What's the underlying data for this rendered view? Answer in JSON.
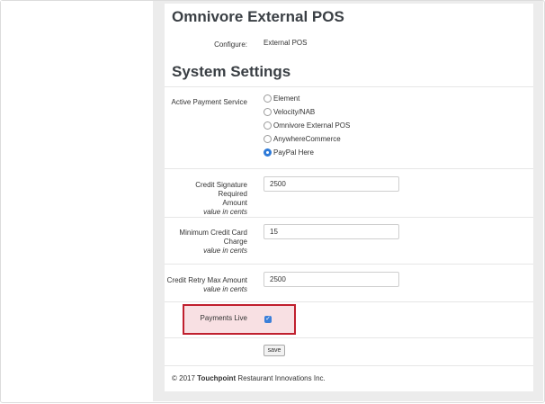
{
  "header": {
    "title": "Omnivore External POS"
  },
  "configure": {
    "label": "Configure:",
    "value": "External POS"
  },
  "system_settings": {
    "title": "System Settings"
  },
  "payment_service": {
    "label": "Active Payment Service",
    "options": [
      "Element",
      "Velocity/NAB",
      "Omnivore External POS",
      "AnywhereCommerce",
      "PayPal Here"
    ],
    "selected": "PayPal Here"
  },
  "credit_signature": {
    "label_line1": "Credit Signature Required",
    "label_line2": "Amount",
    "hint": "value in cents",
    "value": "2500"
  },
  "min_credit": {
    "label_line1": "Minimum Credit Card",
    "label_line2": "Charge",
    "hint": "value in cents",
    "value": "15"
  },
  "credit_retry": {
    "label": "Credit Retry Max Amount",
    "hint": "value in cents",
    "value": "2500"
  },
  "payments_live": {
    "label": "Payments Live",
    "checked": true,
    "check_glyph": "✓"
  },
  "actions": {
    "save_label": "save"
  },
  "footer": {
    "copyright": "© 2017",
    "brand": "Touchpoint",
    "rest": "Restaurant Innovations Inc."
  },
  "colors": {
    "accent": "#2f7bd8",
    "highlight_border": "#c0202e",
    "highlight_fill": "#f8e0e3"
  }
}
